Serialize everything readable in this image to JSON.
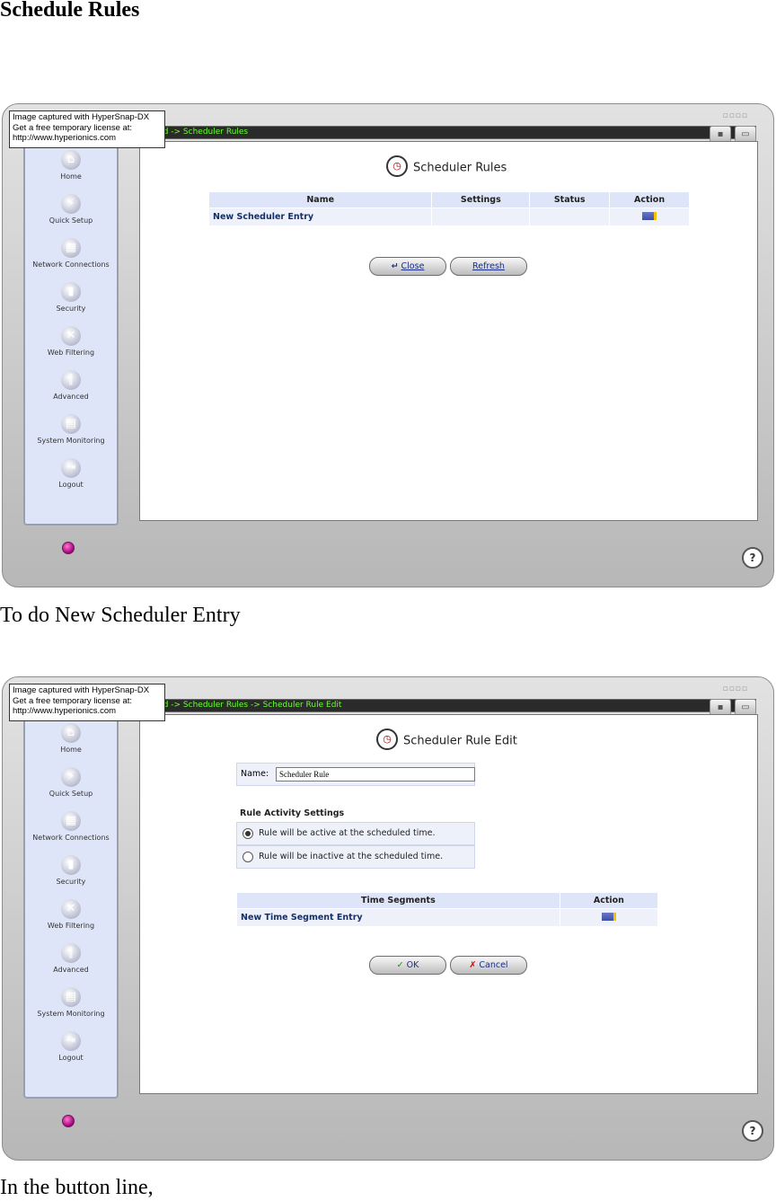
{
  "document": {
    "heading": "Schedule Rules",
    "caption_1": "To do New Scheduler Entry",
    "caption_2": "In the button line,"
  },
  "watermark": {
    "line1": "Image captured with HyperSnap-DX",
    "line2": "Get a free temporary license at:",
    "line3": "http://www.hyperionics.com"
  },
  "sidebar": {
    "items": [
      {
        "label": "Home",
        "icon": "home-icon"
      },
      {
        "label": "Quick Setup",
        "icon": "lightning-icon"
      },
      {
        "label": "Network Connections",
        "icon": "network-icon"
      },
      {
        "label": "Security",
        "icon": "lock-icon"
      },
      {
        "label": "Web Filtering",
        "icon": "filter-icon"
      },
      {
        "label": "Advanced",
        "icon": "tools-icon"
      },
      {
        "label": "System Monitoring",
        "icon": "monitor-icon"
      },
      {
        "label": "Logout",
        "icon": "logout-icon"
      }
    ]
  },
  "screen1": {
    "breadcrumb": "anced -> Scheduler Rules",
    "title": "Scheduler Rules",
    "table": {
      "headers": [
        "Name",
        "Settings",
        "Status",
        "Action"
      ],
      "rows": [
        {
          "name": "New Scheduler Entry",
          "settings": "",
          "status": "",
          "action_icon": "edit-icon"
        }
      ]
    },
    "buttons": {
      "close": "Close",
      "refresh": "Refresh"
    }
  },
  "screen2": {
    "breadcrumb": "anced -> Scheduler Rules -> Scheduler Rule Edit",
    "title": "Scheduler Rule Edit",
    "name_label": "Name:",
    "name_value": "Scheduler Rule",
    "rule_activity_label": "Rule Activity Settings",
    "radio_options": [
      {
        "label": "Rule will be active at the scheduled time.",
        "selected": true
      },
      {
        "label": "Rule will be inactive at the scheduled time.",
        "selected": false
      }
    ],
    "segments_table": {
      "headers": [
        "Time Segments",
        "Action"
      ],
      "rows": [
        {
          "name": "New Time Segment Entry",
          "action_icon": "edit-icon"
        }
      ]
    },
    "buttons": {
      "ok": "OK",
      "cancel": "Cancel"
    }
  },
  "colors": {
    "sidebar_bg": "#dfe5f8",
    "breadcrumb_text": "#6cff32",
    "link_text": "#12306e"
  }
}
